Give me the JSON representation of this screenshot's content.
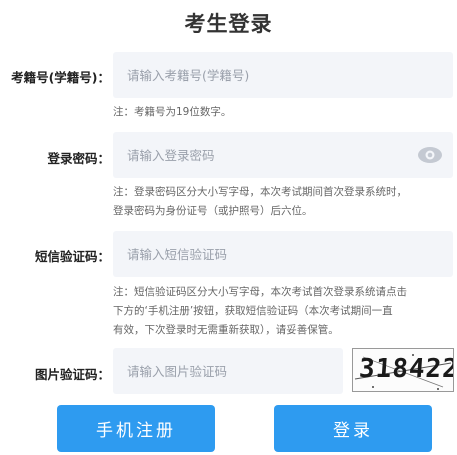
{
  "title": "考生登录",
  "fields": {
    "exam_id": {
      "label": "考籍号(学籍号)：",
      "placeholder": "请输入考籍号(学籍号)",
      "note": "注：考籍号为19位数字。"
    },
    "password": {
      "label": "登录密码：",
      "placeholder": "请输入登录密码",
      "note_line1": "注：登录密码区分大小写字母，本次考试期间首次登录系统时，",
      "note_line2": "登录密码为身份证号（或护照号）后六位。",
      "toggle_icon": "eye-icon"
    },
    "sms_code": {
      "label": "短信验证码：",
      "placeholder": "请输入短信验证码",
      "note_line1": "注：短信验证码区分大小写字母，本次考试首次登录系统请点击",
      "note_line2": "下方的‘手机注册’按钮，获取短信验证码（本次考试期间一直",
      "note_line3": "有效，下次登录时无需重新获取），请妥善保管。"
    },
    "image_code": {
      "label": "图片验证码：",
      "placeholder": "请输入图片验证码",
      "captcha_text": "318422"
    }
  },
  "buttons": {
    "register": "手机注册",
    "login": "登录"
  },
  "colors": {
    "primary": "#2e9bf0",
    "field_bg": "#f3f5f9"
  }
}
